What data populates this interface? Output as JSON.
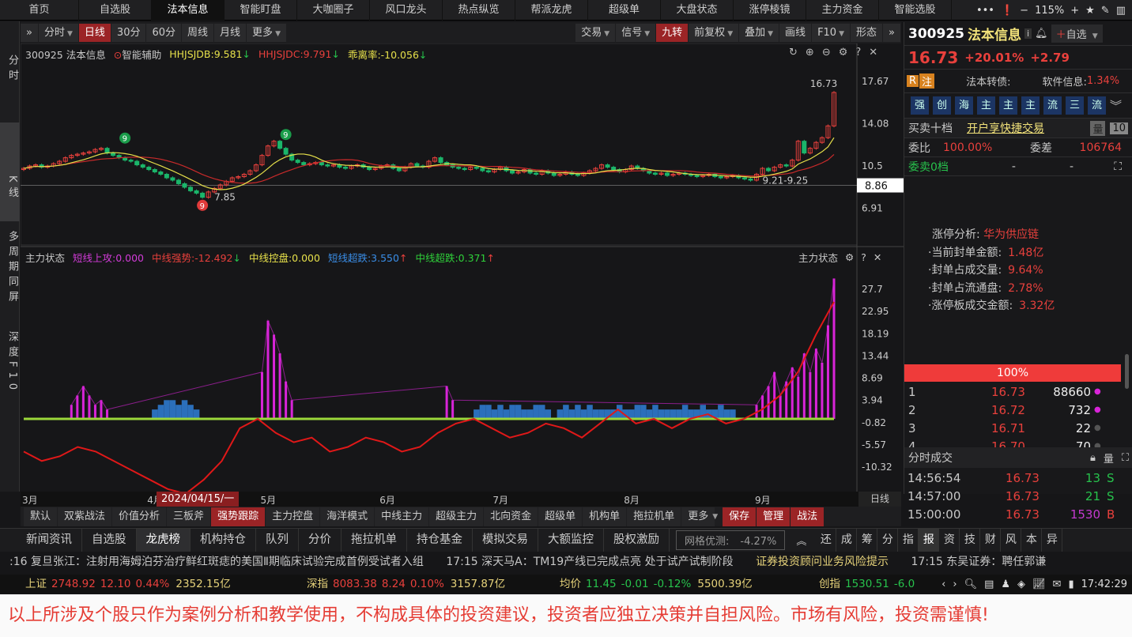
{
  "topnav": {
    "tabs": [
      "首页",
      "自选股",
      "法本信息",
      "智能盯盘",
      "大咖圈子",
      "风口龙头",
      "热点纵览",
      "帮派龙虎",
      "超级单",
      "大盘状态",
      "涨停棱镜",
      "主力资金",
      "智能选股"
    ],
    "active": 2,
    "zoom": "115%"
  },
  "leftstrip": {
    "items": [
      "分时",
      "K线",
      "多周期同屏",
      "深度F10"
    ]
  },
  "toolbar": {
    "left": [
      {
        "l": "分时",
        "c": true
      },
      {
        "l": "日线",
        "r": true
      },
      {
        "l": "30分"
      },
      {
        "l": "60分"
      },
      {
        "l": "周线"
      },
      {
        "l": "月线"
      },
      {
        "l": "更多",
        "c": true
      }
    ],
    "right": [
      {
        "l": "交易",
        "c": true
      },
      {
        "l": "信号",
        "c": true
      },
      {
        "l": "九转",
        "r": true
      },
      {
        "l": "前复权",
        "c": true
      },
      {
        "l": "叠加",
        "c": true
      },
      {
        "l": "画线"
      },
      {
        "l": "F10",
        "c": true
      },
      {
        "l": "形态"
      }
    ]
  },
  "kline_header": {
    "stock": "300925 法本信息",
    "assist": "智能辅助",
    "hhjsjdb": "HHJSJDB:9.581",
    "hhjsjdc": "HHJSJDC:9.791",
    "deviation": "乖离率:-10.056"
  },
  "ind_header": {
    "name": "主力状态",
    "s1": "短线上攻:0.000",
    "s2": "中线强势:-12.492",
    "s3": "中线控盘:0.000",
    "s4": "短线超跌:3.550",
    "s5": "中线超跌:0.371",
    "right_label": "主力状态"
  },
  "chart_data": {
    "type": "candlestick",
    "price_ticks": [
      17.67,
      14.08,
      10.5,
      6.91
    ],
    "current_price_tag": "8.86",
    "closes": [
      10.3,
      10.5,
      10.6,
      10.4,
      10.5,
      10.7,
      10.9,
      11.2,
      11.4,
      11.5,
      11.6,
      11.7,
      11.9,
      12.0,
      11.6,
      11.4,
      11.2,
      11.0,
      10.9,
      10.6,
      10.4,
      10.2,
      10.0,
      9.8,
      9.5,
      9.3,
      9.0,
      8.7,
      8.4,
      8.2,
      7.85,
      8.3,
      8.6,
      8.9,
      9.2,
      9.5,
      9.6,
      9.8,
      10.1,
      10.6,
      11.4,
      12.2,
      12.6,
      12.0,
      11.5,
      11.0,
      10.8,
      10.6,
      10.7,
      10.8,
      10.6,
      10.5,
      10.6,
      10.4,
      10.3,
      10.5,
      10.6,
      10.4,
      10.2,
      10.3,
      10.5,
      10.6,
      10.3,
      10.1,
      10.4,
      10.7,
      10.5,
      10.4,
      10.9,
      11.2,
      10.8,
      10.6,
      10.4,
      10.3,
      10.2,
      10.4,
      10.3,
      10.1,
      10.0,
      10.2,
      10.4,
      10.1,
      9.9,
      10.0,
      10.2,
      9.9,
      9.8,
      10.1,
      9.9,
      9.7,
      9.8,
      10.0,
      9.8,
      9.7,
      9.9,
      10.1,
      10.3,
      10.6,
      10.4,
      10.2,
      10.0,
      10.2,
      10.5,
      10.3,
      10.1,
      9.9,
      9.8,
      9.9,
      9.7,
      9.8,
      9.9,
      9.8,
      9.7,
      9.6,
      9.7,
      9.8,
      9.6,
      9.5,
      9.6,
      9.7,
      9.5,
      9.4,
      9.3,
      9.8,
      10.3,
      10.1,
      10.4,
      10.6,
      10.5,
      11.0,
      12.6,
      11.6,
      12.0,
      12.5,
      12.9,
      13.9,
      16.73
    ],
    "annotations": [
      {
        "d": 17,
        "p": 12.6,
        "t": "9"
      },
      {
        "d": 44,
        "p": 12.9,
        "t": "9"
      },
      {
        "d": 32,
        "p": 7.6,
        "t": "7.85"
      },
      {
        "d": 30,
        "p": 6.9,
        "t": "9"
      },
      {
        "d": 124,
        "p": 9.0,
        "t": "9.21-9.25"
      },
      {
        "d": 132,
        "p": 17.2,
        "t": "16.73"
      }
    ],
    "month_labels": [
      "3月",
      "4月",
      "5月",
      "6月",
      "7月",
      "8月",
      "9月"
    ],
    "month_start_days": [
      0,
      21,
      40,
      60,
      79,
      101,
      123
    ],
    "cursor_date": "2024/04/15/一",
    "period_label": "日线",
    "ind_ticks": [
      27.7,
      22.95,
      18.19,
      13.44,
      8.69,
      3.94,
      -0.82,
      -5.57,
      -10.32
    ],
    "mid_strength_line": [
      -7,
      -9,
      -8,
      -6,
      -7,
      -9,
      -11,
      -13,
      -15,
      -16,
      -13,
      -9,
      -2,
      0,
      -3,
      -5,
      -4,
      -7,
      -6,
      -4,
      -5,
      -7,
      -6,
      -3,
      -1,
      0,
      -2,
      -4,
      -3,
      -1,
      -2,
      -4,
      -1,
      2,
      -1,
      0,
      -2,
      0,
      1,
      -1,
      0,
      2,
      5,
      10,
      18,
      25
    ],
    "short_oversold": [
      0,
      0,
      0,
      0,
      0,
      0,
      0,
      0,
      0,
      0,
      0,
      0,
      0,
      0,
      0,
      0,
      0,
      0,
      0,
      0,
      0,
      0,
      2,
      3,
      4,
      4,
      3,
      4,
      3,
      2,
      0,
      0,
      0,
      0,
      0,
      0,
      0,
      0,
      0,
      0,
      0,
      0,
      0,
      0,
      0,
      0,
      0,
      0,
      0,
      0,
      0,
      0,
      0,
      0,
      0,
      0,
      0,
      0,
      0,
      0,
      0,
      0,
      0,
      0,
      0,
      0,
      0,
      0,
      0,
      0,
      0,
      0,
      0,
      0,
      0,
      0,
      2,
      3,
      3,
      2,
      3,
      2,
      3,
      3,
      2,
      2,
      3,
      3,
      2,
      0,
      2,
      3,
      2,
      3,
      2,
      3,
      2,
      2,
      2,
      2,
      3,
      2,
      2,
      3,
      3,
      2,
      3,
      2,
      2,
      2,
      2,
      3,
      2,
      2,
      3,
      2,
      2,
      3,
      2,
      2,
      0,
      0,
      0,
      0,
      0,
      0,
      0,
      0,
      0,
      0,
      0,
      0,
      0,
      0,
      0,
      0,
      0
    ],
    "short_attack": [
      [
        8,
        3
      ],
      [
        9,
        5
      ],
      [
        10,
        7
      ],
      [
        11,
        5
      ],
      [
        12,
        3
      ],
      [
        13,
        4
      ],
      [
        14,
        2
      ],
      [
        40,
        10
      ],
      [
        41,
        21
      ],
      [
        42,
        18
      ],
      [
        43,
        14
      ],
      [
        44,
        8
      ],
      [
        45,
        4
      ],
      [
        71,
        7
      ],
      [
        72,
        4
      ],
      [
        123,
        3
      ],
      [
        124,
        5
      ],
      [
        125,
        7
      ],
      [
        126,
        10
      ],
      [
        127,
        5
      ],
      [
        128,
        8
      ],
      [
        129,
        11
      ],
      [
        130,
        9
      ],
      [
        131,
        14
      ],
      [
        132,
        10
      ],
      [
        133,
        15
      ],
      [
        134,
        12
      ],
      [
        135,
        20
      ],
      [
        136,
        30
      ]
    ],
    "colors": {
      "up": "#e8403c",
      "down": "#1bb56a",
      "ma_yellow": "#e6e04a",
      "ma_red": "#c82a2a",
      "attack": "#d824d8",
      "oversold": "#2f7fd8",
      "line": "#e01818",
      "zero": "#9bd83a"
    }
  },
  "quote": {
    "code": "300925",
    "name": "法本信息",
    "price": "16.73",
    "pct": "+20.01%",
    "chg": "+2.79",
    "add_fav": "自选",
    "badges": [
      "R",
      "注"
    ],
    "bond": "法本转债:",
    "sector": "软件信息:",
    "sector_pct": "1.34%",
    "tags": [
      "强",
      "创",
      "海",
      "主",
      "主",
      "主",
      "流",
      "三",
      "流"
    ],
    "book_title": "买卖十档",
    "book_link": "开户享快捷交易",
    "book_btn": "10",
    "ratio_label": "委比",
    "ratio": "100.00%",
    "diff_label": "委差",
    "diff": "106764",
    "ask0": "委卖0档",
    "dash": "-"
  },
  "limit": {
    "title": "涨停分析:",
    "concept": "华为供应链",
    "rows": [
      {
        "k": "·当前封单金额:",
        "v": "1.48亿"
      },
      {
        "k": "·封单占成交量:",
        "v": "9.64%"
      },
      {
        "k": "·封单占流通盘:",
        "v": "2.78%"
      },
      {
        "k": "·涨停板成交金额:",
        "v": "3.32亿"
      }
    ]
  },
  "bids": {
    "bar": "100%",
    "rows": [
      {
        "n": "1",
        "p": "16.73",
        "v": "88660",
        "dot": "#d824d8"
      },
      {
        "n": "2",
        "p": "16.72",
        "v": "732",
        "dot": "#d824d8"
      },
      {
        "n": "3",
        "p": "16.71",
        "v": "22",
        "dot": "#555"
      },
      {
        "n": "4",
        "p": "16.70",
        "v": "70",
        "dot": "#555"
      }
    ]
  },
  "ticks": {
    "title": "分时成交",
    "rows": [
      {
        "t": "14:56:54",
        "p": "16.73",
        "v": "13",
        "s": "S"
      },
      {
        "t": "14:57:00",
        "p": "16.73",
        "v": "21",
        "s": "S"
      },
      {
        "t": "15:00:00",
        "p": "16.73",
        "v": "1530",
        "s": "B"
      }
    ]
  },
  "strategies": {
    "items": [
      "默认",
      "双紫战法",
      "价值分析",
      "三板斧",
      "强势跟踪",
      "主力控盘",
      "海洋模式",
      "中线主力",
      "超级主力",
      "北向资金",
      "超级单",
      "机构单",
      "拖拉机单",
      "更多"
    ],
    "active": 4,
    "actions": [
      "保存",
      "管理",
      "战法"
    ]
  },
  "bottom_tabs": {
    "items": [
      "新闻资讯",
      "自选股",
      "龙虎榜",
      "机构持仓",
      "队列",
      "分价",
      "拖拉机单",
      "持仓基金",
      "模拟交易",
      "大额监控",
      "股权激励"
    ],
    "active": 2,
    "grid_label": "网格优测:",
    "grid_value": "-4.27%",
    "small": [
      "还",
      "成",
      "筹",
      "分",
      "指",
      "报",
      "资",
      "技",
      "财",
      "风",
      "本",
      "异"
    ],
    "small_active": 5
  },
  "news": {
    "n1": ":16 复旦张江：注射用海姆泊芬治疗鲜红斑痣的美国Ⅱ期临床试验完成首例受试者入组",
    "n2": "17:15 深天马A：TM19产线已完成点亮 处于试产试制阶段",
    "n3": "证券投资顾问业务风险提示",
    "n4": "17:15 东吴证券：聘任郭谦"
  },
  "indices": [
    {
      "name": "上证",
      "v": "2748.92",
      "c": "12.10",
      "p": "0.44%",
      "a": "2352.15亿",
      "col": "red"
    },
    {
      "name": "深指",
      "v": "8083.38",
      "c": "8.24",
      "p": "0.10%",
      "a": "3157.87亿",
      "col": "red"
    },
    {
      "name": "均价",
      "v": "11.45",
      "c": "-0.01",
      "p": "-0.12%",
      "a": "5500.39亿",
      "col": "grn"
    },
    {
      "name": "创指",
      "v": "1530.51",
      "c": "-6.0",
      "p": "",
      "a": "",
      "col": "grn"
    }
  ],
  "clock": "17:42:29",
  "disclaimer": "以上所涉及个股只作为案例分析和教学使用，不构成具体的投资建议，投资者应独立决策并自担风险。市场有风险，投资需谨慎!"
}
